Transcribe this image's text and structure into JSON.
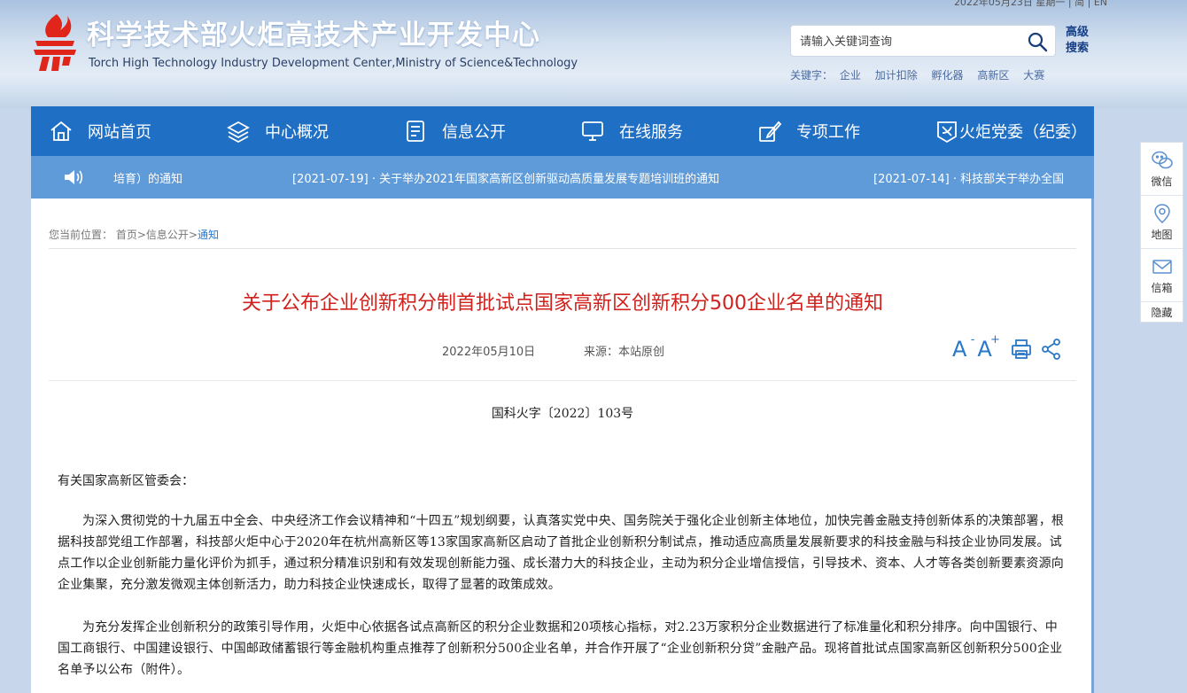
{
  "header": {
    "top_strip": "2022年05月23日 星期一 | 简 | EN",
    "site_title": "科学技术部火炬高技术产业开发中心",
    "site_subtitle": "Torch High Technology Industry Development Center,Ministry of Science&Technology",
    "search_placeholder": "请输入关键词查询",
    "advanced_search_line1": "高级",
    "advanced_search_line2": "搜索",
    "hotwords_label": "关键字：",
    "hotwords": [
      "企业",
      "加计扣除",
      "孵化器",
      "高新区",
      "大赛"
    ]
  },
  "nav": {
    "items": [
      {
        "label": "网站首页",
        "icon": "home-icon"
      },
      {
        "label": "中心概况",
        "icon": "layers-icon"
      },
      {
        "label": "信息公开",
        "icon": "document-icon"
      },
      {
        "label": "在线服务",
        "icon": "monitor-icon"
      },
      {
        "label": "专项工作",
        "icon": "pen-icon"
      },
      {
        "label": "火炬党委（纪委）",
        "icon": "party-emblem-icon"
      }
    ]
  },
  "ticker": {
    "icon": "speaker-icon",
    "items": [
      "培育）的通知",
      "[2021-07-19] · 关于举办2021年国家高新区创新驱动高质量发展专题培训班的通知",
      "[2021-07-14] · 科技部关于举办全国"
    ]
  },
  "breadcrumb": {
    "prefix": "您当前位置：",
    "home": "首页",
    "sep1": ">",
    "level1": "信息公开",
    "sep2": ">",
    "current": "通知"
  },
  "article": {
    "title": "关于公布企业创新积分制首批试点国家高新区创新积分500企业名单的通知",
    "date": "2022年05月10日",
    "source": "来源：本站原创",
    "doc_number": "国科火字〔2022〕103号",
    "salutation": "有关国家高新区管委会：",
    "paragraphs": [
      "为深入贯彻党的十九届五中全会、中央经济工作会议精神和“十四五”规划纲要，认真落实党中央、国务院关于强化企业创新主体地位，加快完善金融支持创新体系的决策部署，根据科技部党组工作部署，科技部火炬中心于2020年在杭州高新区等13家国家高新区启动了首批企业创新积分制试点，推动适应高质量发展新要求的科技金融与科技企业协同发展。试点工作以企业创新能力量化评价为抓手，通过积分精准识别和有效发现创新能力强、成长潜力大的科技企业，主动为积分企业增信授信，引导技术、资本、人才等各类创新要素资源向企业集聚，充分激发微观主体创新活力，助力科技企业快速成长，取得了显著的政策成效。",
      "为充分发挥企业创新积分的政策引导作用，火炬中心依据各试点高新区的积分企业数据和20项核心指标，对2.23万家积分企业数据进行了标准量化和积分排序。向中国银行、中国工商银行、中国建设银行、中国邮政储蓄银行等金融机构重点推荐了创新积分500企业名单，并合作开展了“企业创新积分贷”金融产品。现将首批试点国家高新区创新积分500企业名单予以公布（附件）。"
    ]
  },
  "tools": {
    "font_smaller": "A",
    "font_smaller_sup": "-",
    "font_larger": "A",
    "font_larger_sup": "+"
  },
  "side_panel": {
    "wechat": "微信",
    "map": "地图",
    "mail": "信箱",
    "hide": "隐藏"
  },
  "colors": {
    "nav_bg": "#1f6fc5",
    "ticker_bg": "#5f9bd9",
    "title_red": "#d0211c",
    "link_blue": "#2a77c8"
  }
}
